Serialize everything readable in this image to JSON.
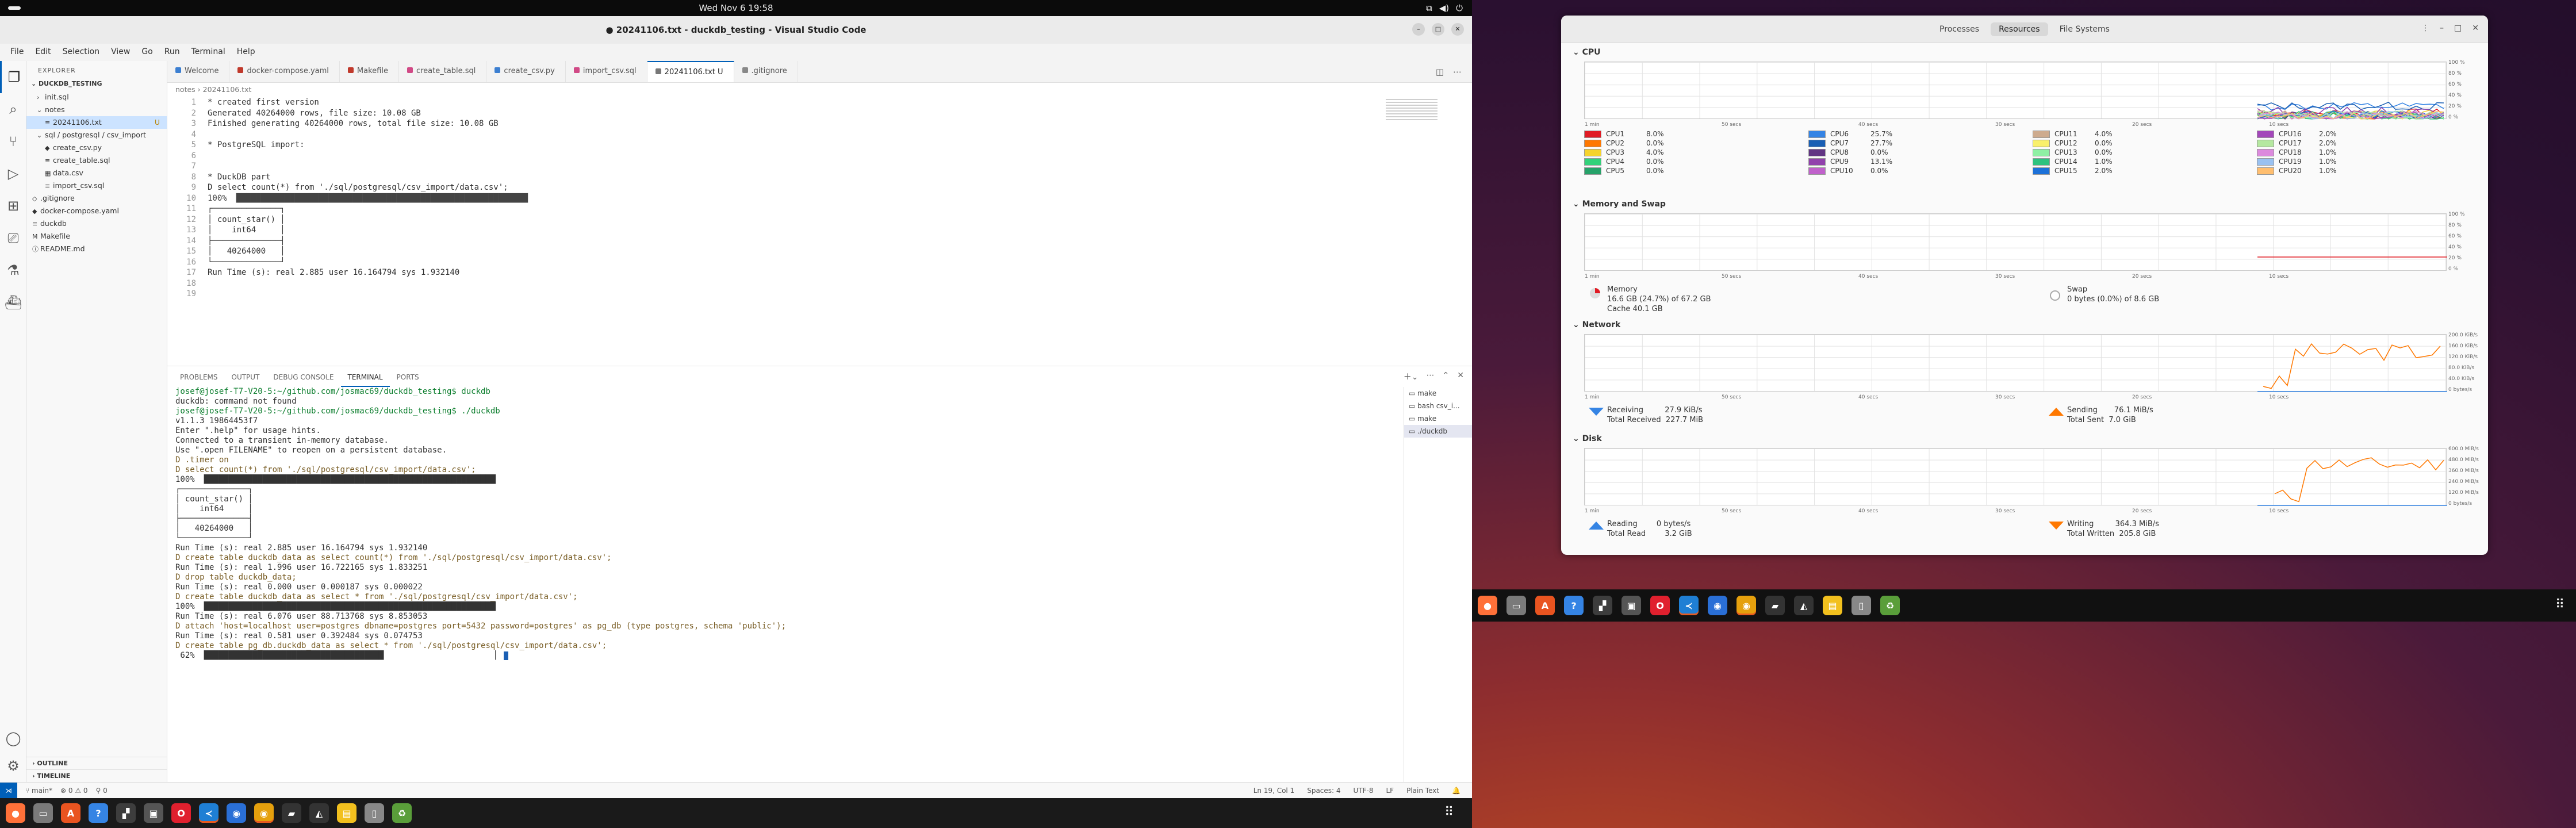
{
  "system": {
    "clock": "Wed Nov 6  19:58"
  },
  "vscode": {
    "title": "● 20241106.txt - duckdb_testing - Visual Studio Code",
    "menu": [
      "File",
      "Edit",
      "Selection",
      "View",
      "Go",
      "Run",
      "Terminal",
      "Help"
    ],
    "explorer": {
      "header": "EXPLORER",
      "root": "DUCKDB_TESTING",
      "items": [
        {
          "label": "init.sql",
          "icon": "›"
        },
        {
          "label": "notes",
          "icon": "⌄"
        },
        {
          "label": "20241106.txt",
          "icon": "≡",
          "badge": "U"
        },
        {
          "label": "sql / postgresql / csv_import",
          "icon": "⌄"
        },
        {
          "label": "create_csv.py",
          "icon": "◆"
        },
        {
          "label": "create_table.sql",
          "icon": "≡"
        },
        {
          "label": "data.csv",
          "icon": "▦"
        },
        {
          "label": "import_csv.sql",
          "icon": "≡"
        },
        {
          "label": ".gitignore",
          "icon": "◇"
        },
        {
          "label": "docker-compose.yaml",
          "icon": "◆"
        },
        {
          "label": "duckdb",
          "icon": "≡"
        },
        {
          "label": "Makefile",
          "icon": "M"
        },
        {
          "label": "README.md",
          "icon": "ⓘ"
        }
      ],
      "outline": "OUTLINE",
      "timeline": "TIMELINE"
    },
    "tabs": [
      {
        "label": "Welcome",
        "color": "#3c7fd1"
      },
      {
        "label": "docker-compose.yaml",
        "color": "#c0392b"
      },
      {
        "label": "Makefile",
        "color": "#c0392b"
      },
      {
        "label": "create_table.sql",
        "color": "#d14a86"
      },
      {
        "label": "create_csv.py",
        "color": "#3c7fd1"
      },
      {
        "label": "import_csv.sql",
        "color": "#d14a86"
      },
      {
        "label": "20241106.txt U",
        "color": "#777"
      },
      {
        "label": ".gitignore",
        "color": "#888"
      }
    ],
    "breadcrumb": "notes  ›  20241106.txt",
    "editor_lines": [
      "* created first version",
      "Generated 40264000 rows, file size: 10.08 GB",
      "Finished generating 40264000 rows, total file size: 10.08 GB",
      "",
      "* PostgreSQL import:",
      "",
      "",
      "* DuckDB part",
      "D select count(*) from './sql/postgresql/csv_import/data.csv';",
      "100% ▕████████████████████████████████████████████████████████████▏",
      "┌──────────────┐",
      "│ count_star() │",
      "│    int64     │",
      "├──────────────┤",
      "│   40264000   │",
      "└──────────────┘",
      "Run Time (s): real 2.885 user 16.164794 sys 1.932140",
      "",
      ""
    ],
    "panel_tabs": [
      "PROBLEMS",
      "OUTPUT",
      "DEBUG CONSOLE",
      "TERMINAL",
      "PORTS"
    ],
    "terminal_lines": [
      "josef@josef-T7-V20-5:~/github.com/josmac69/duckdb_testing$ duckdb",
      "duckdb: command not found",
      "josef@josef-T7-V20-5:~/github.com/josmac69/duckdb_testing$ ./duckdb",
      "v1.1.3 19864453f7",
      "Enter \".help\" for usage hints.",
      "Connected to a transient in-memory database.",
      "Use \".open FILENAME\" to reopen on a persistent database.",
      "D .timer on",
      "D select count(*) from './sql/postgresql/csv_import/data.csv';",
      "100% ▕████████████████████████████████████████████████████████████▏",
      "┌──────────────┐",
      "│ count_star() │",
      "│    int64     │",
      "├──────────────┤",
      "│   40264000   │",
      "└──────────────┘",
      "Run Time (s): real 2.885 user 16.164794 sys 1.932140",
      "D create table duckdb_data as select count(*) from './sql/postgresql/csv_import/data.csv';",
      "Run Time (s): real 1.996 user 16.722165 sys 1.833251",
      "D drop table duckdb_data;",
      "Run Time (s): real 0.000 user 0.000187 sys 0.000022",
      "D create table duckdb_data as select * from './sql/postgresql/csv_import/data.csv';",
      "100% ▕████████████████████████████████████████████████████████████▏",
      "Run Time (s): real 6.076 user 88.713768 sys 8.853053",
      "D attach 'host=localhost user=postgres dbname=postgres port=5432 password=postgres' as pg_db (type postgres, schema 'public');",
      "Run Time (s): real 0.581 user 0.392484 sys 0.074753",
      "D create table pg_db.duckdb_data as select * from './sql/postgresql/csv_import/data.csv';",
      " 62% ▕█████████████████████████████████████                       ▏"
    ],
    "terminal_list": [
      "make",
      "bash csv_i...",
      "make",
      "./duckdb"
    ],
    "status": {
      "branch": "main*",
      "problems": "⊗ 0 ⚠ 0",
      "ports": "⚲ 0",
      "position": "Ln 19, Col 1",
      "spaces": "Spaces: 4",
      "encoding": "UTF-8",
      "eol": "LF",
      "language": "Plain Text"
    }
  },
  "sysmon": {
    "tabs": [
      "Processes",
      "Resources",
      "File Systems"
    ],
    "cpu": {
      "title": "CPU",
      "yticks": [
        "100 %",
        "80 %",
        "60 %",
        "40 %",
        "20 %",
        "0 %"
      ],
      "xticks": [
        "1 min",
        "50 secs",
        "40 secs",
        "30 secs",
        "20 secs",
        "10 secs"
      ],
      "cores": [
        {
          "name": "CPU1",
          "value": "8.0%",
          "color": "#e01b24"
        },
        {
          "name": "CPU2",
          "value": "0.0%",
          "color": "#ff7800"
        },
        {
          "name": "CPU3",
          "value": "4.0%",
          "color": "#f6d32d"
        },
        {
          "name": "CPU4",
          "value": "0.0%",
          "color": "#33d17a"
        },
        {
          "name": "CPU5",
          "value": "0.0%",
          "color": "#26a269"
        },
        {
          "name": "CPU6",
          "value": "25.7%",
          "color": "#3584e4"
        },
        {
          "name": "CPU7",
          "value": "27.7%",
          "color": "#1a5fb4"
        },
        {
          "name": "CPU8",
          "value": "0.0%",
          "color": "#613583"
        },
        {
          "name": "CPU9",
          "value": "13.1%",
          "color": "#9141ac"
        },
        {
          "name": "CPU10",
          "value": "0.0%",
          "color": "#c061cb"
        },
        {
          "name": "CPU11",
          "value": "4.0%",
          "color": "#cdab8f"
        },
        {
          "name": "CPU12",
          "value": "0.0%",
          "color": "#f9f06b"
        },
        {
          "name": "CPU13",
          "value": "0.0%",
          "color": "#8ff0a4"
        },
        {
          "name": "CPU14",
          "value": "1.0%",
          "color": "#2ec27e"
        },
        {
          "name": "CPU15",
          "value": "2.0%",
          "color": "#1c71d8"
        },
        {
          "name": "CPU16",
          "value": "2.0%",
          "color": "#a347ba"
        },
        {
          "name": "CPU17",
          "value": "2.0%",
          "color": "#b5e8a0"
        },
        {
          "name": "CPU18",
          "value": "1.0%",
          "color": "#dc8add"
        },
        {
          "name": "CPU19",
          "value": "1.0%",
          "color": "#99c1f1"
        },
        {
          "name": "CPU20",
          "value": "1.0%",
          "color": "#ffbe6f"
        }
      ]
    },
    "memory": {
      "title": "Memory and Swap",
      "yticks": [
        "100 %",
        "80 %",
        "60 %",
        "40 %",
        "20 %",
        "0 %"
      ],
      "xticks": [
        "1 min",
        "50 secs",
        "40 secs",
        "30 secs",
        "20 secs",
        "10 secs"
      ],
      "mem_label": "Memory",
      "mem_value": "16.6 GB (24.7%) of 67.2 GB",
      "cache": "Cache 40.1 GB",
      "swap_label": "Swap",
      "swap_value": "0 bytes (0.0%) of 8.6 GB"
    },
    "network": {
      "title": "Network",
      "yticks": [
        "200.0 KiB/s",
        "160.0 KiB/s",
        "120.0 KiB/s",
        "80.0 KiB/s",
        "40.0 KiB/s",
        "0 bytes/s"
      ],
      "xticks": [
        "1 min",
        "50 secs",
        "40 secs",
        "30 secs",
        "20 secs",
        "10 secs"
      ],
      "receiving_label": "Receiving",
      "receiving": "27.9 KiB/s",
      "total_received_label": "Total Received",
      "total_received": "227.7 MiB",
      "sending_label": "Sending",
      "sending": "76.1 MiB/s",
      "total_sent_label": "Total Sent",
      "total_sent": "7.0 GiB"
    },
    "disk": {
      "title": "Disk",
      "yticks": [
        "600.0 MiB/s",
        "480.0 MiB/s",
        "360.0 MiB/s",
        "240.0 MiB/s",
        "120.0 MiB/s",
        "0 bytes/s"
      ],
      "xticks": [
        "1 min",
        "50 secs",
        "40 secs",
        "30 secs",
        "20 secs",
        "10 secs"
      ],
      "reading_label": "Reading",
      "reading": "0 bytes/s",
      "total_read_label": "Total Read",
      "total_read": "3.2 GiB",
      "writing_label": "Writing",
      "writing": "364.3 MiB/s",
      "total_written_label": "Total Written",
      "total_written": "205.8 GiB"
    }
  },
  "dock": [
    {
      "name": "firefox",
      "glyph": "●",
      "color": "#ff7139"
    },
    {
      "name": "files",
      "glyph": "▭",
      "color": "#7a7a7a"
    },
    {
      "name": "app-center",
      "glyph": "A",
      "color": "#e95420"
    },
    {
      "name": "help",
      "glyph": "?",
      "color": "#3584e4"
    },
    {
      "name": "system-monitor",
      "glyph": "▞",
      "color": "#3d3d3d"
    },
    {
      "name": "screenshot",
      "glyph": "▣",
      "color": "#555"
    },
    {
      "name": "opera",
      "glyph": "O",
      "color": "#e0202e"
    },
    {
      "name": "vscode",
      "glyph": "≺",
      "color": "#1f7fd4"
    },
    {
      "name": "chromium",
      "glyph": "◉",
      "color": "#2a6fd6"
    },
    {
      "name": "chrome",
      "glyph": "◉",
      "color": "#e5a00d"
    },
    {
      "name": "terminal",
      "glyph": "▰",
      "color": "#333"
    },
    {
      "name": "inkscape",
      "glyph": "◭",
      "color": "#333"
    },
    {
      "name": "notes",
      "glyph": "▤",
      "color": "#f2c01e"
    },
    {
      "name": "text-editor",
      "glyph": "▯",
      "color": "#888"
    },
    {
      "name": "trash",
      "glyph": "♻",
      "color": "#5a9e3a"
    }
  ]
}
